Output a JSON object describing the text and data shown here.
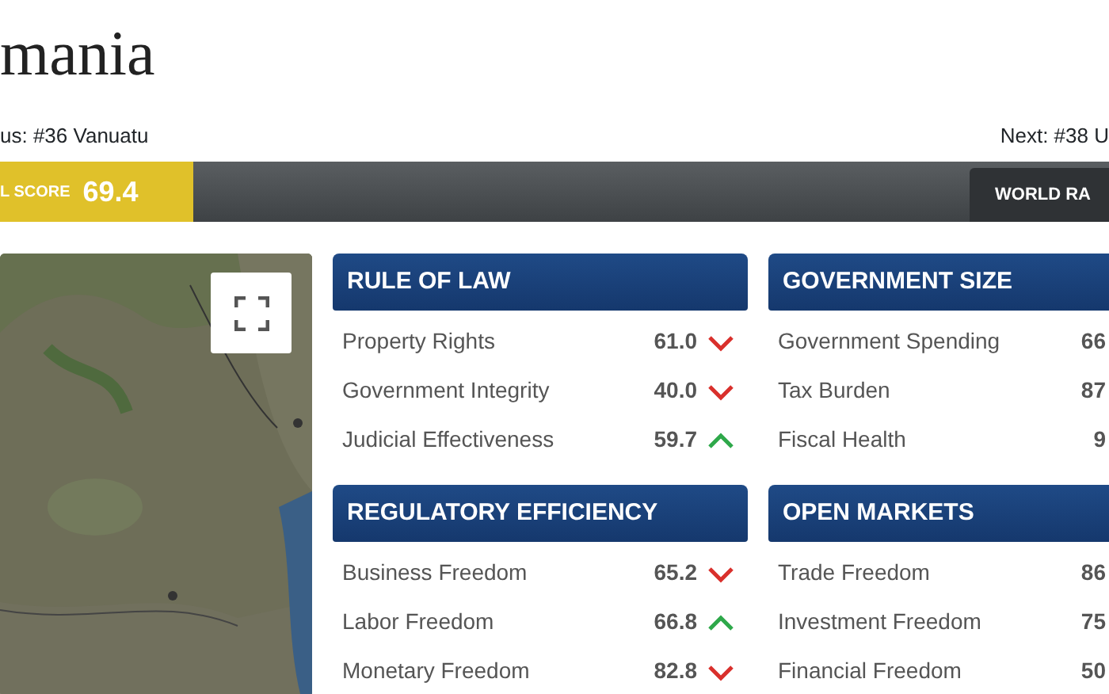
{
  "title": "mania",
  "nav": {
    "previous": "us: #36 Vanuatu",
    "next": "Next: #38 U"
  },
  "score_bar": {
    "label": "L SCORE",
    "score": "69.4",
    "tab": "WORLD RA"
  },
  "columns": [
    {
      "sections": [
        {
          "title": "RULE OF LAW",
          "items": [
            {
              "name": "Property Rights",
              "value": "61.0",
              "rising": false
            },
            {
              "name": "Government Integrity",
              "value": "40.0",
              "rising": false
            },
            {
              "name": "Judicial Effectiveness",
              "value": "59.7",
              "rising": true
            }
          ]
        },
        {
          "title": "REGULATORY EFFICIENCY",
          "items": [
            {
              "name": "Business Freedom",
              "value": "65.2",
              "rising": false
            },
            {
              "name": "Labor Freedom",
              "value": "66.8",
              "rising": true
            },
            {
              "name": "Monetary Freedom",
              "value": "82.8",
              "rising": false
            }
          ]
        }
      ]
    },
    {
      "sections": [
        {
          "title": "GOVERNMENT SIZE",
          "items": [
            {
              "name": "Government Spending",
              "value": "66"
            },
            {
              "name": "Tax Burden",
              "value": "87"
            },
            {
              "name": "Fiscal Health",
              "value": "9"
            }
          ]
        },
        {
          "title": "OPEN MARKETS",
          "items": [
            {
              "name": "Trade Freedom",
              "value": "86"
            },
            {
              "name": "Investment Freedom",
              "value": "75"
            },
            {
              "name": "Financial Freedom",
              "value": "50"
            }
          ]
        }
      ]
    }
  ]
}
